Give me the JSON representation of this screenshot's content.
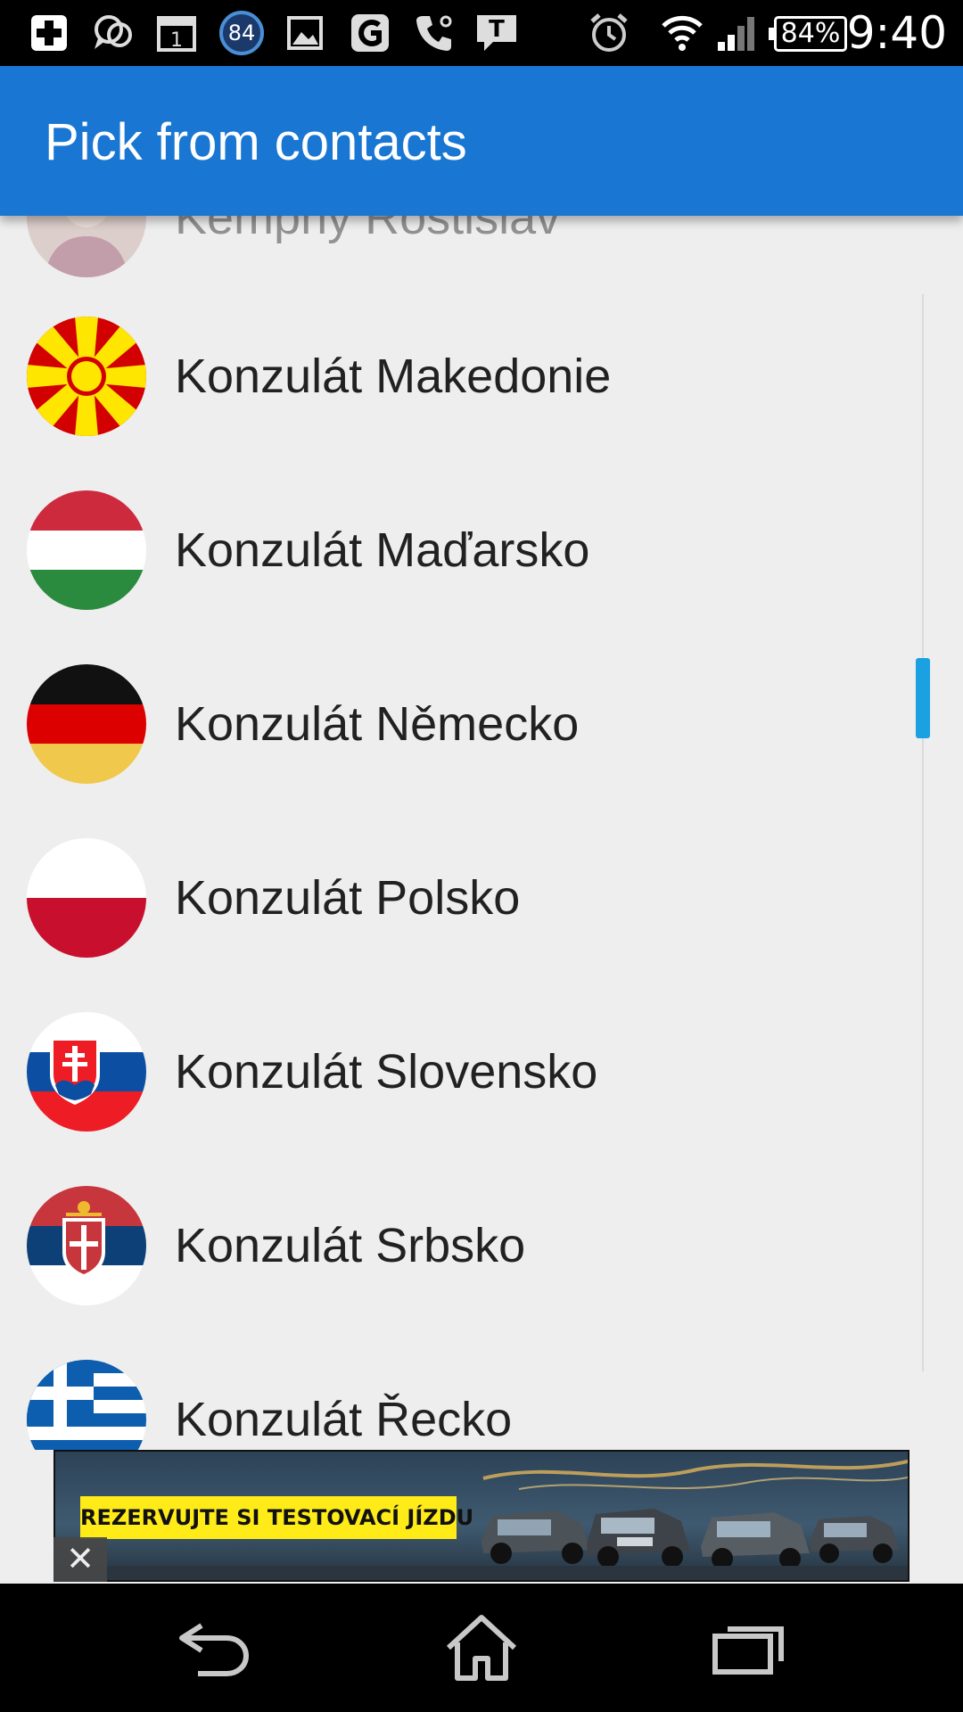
{
  "status_bar": {
    "time": "9:40",
    "battery": "84%",
    "badge_count": "84",
    "calendar_day": "1",
    "icons": [
      "medical-cross-icon",
      "chat-bubble-icon",
      "calendar-icon",
      "circle-badge-icon",
      "image-icon",
      "g-app-icon",
      "phone-settings-icon",
      "t-message-icon",
      "alarm-icon",
      "wifi-icon",
      "signal-icon",
      "battery-icon"
    ]
  },
  "app_bar": {
    "title": "Pick from contacts",
    "color": "#1976d2"
  },
  "contacts": [
    {
      "name": "Kemphy Rostislav",
      "avatar": "person-photo"
    },
    {
      "name": "Konzulát Makedonie",
      "avatar": "flag-macedonia"
    },
    {
      "name": "Konzulát Maďarsko",
      "avatar": "flag-hungary"
    },
    {
      "name": "Konzulát Německo",
      "avatar": "flag-germany"
    },
    {
      "name": "Konzulát Polsko",
      "avatar": "flag-poland"
    },
    {
      "name": "Konzulát Slovensko",
      "avatar": "flag-slovakia"
    },
    {
      "name": "Konzulát Srbsko",
      "avatar": "flag-serbia"
    },
    {
      "name": "Konzulát Řecko",
      "avatar": "flag-greece"
    }
  ],
  "ad": {
    "cta": "REZERVUJTE SI TESTOVACÍ JÍZDU",
    "close_icon": "close-icon"
  },
  "nav_bar": {
    "icons": [
      "back-icon",
      "home-icon",
      "recent-apps-icon"
    ]
  },
  "colors": {
    "accent": "#1976d2",
    "scrollbar": "#1ba1e2",
    "background": "#eeeeee"
  }
}
